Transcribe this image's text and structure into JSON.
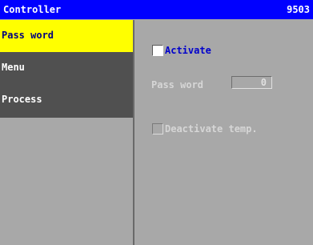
{
  "titlebar": {
    "title": "Controller",
    "code": "9503"
  },
  "sidebar": {
    "items": [
      {
        "label": "Pass word",
        "active": true
      },
      {
        "label": "Menu",
        "active": false
      },
      {
        "label": "Process",
        "active": false
      }
    ]
  },
  "main": {
    "activate_label": "Activate",
    "activate_checked": false,
    "password_label": "Pass word",
    "password_value": "0",
    "deactivate_label": "Deactivate temp.",
    "deactivate_checked": false
  },
  "colors": {
    "titlebar": "#0000ff",
    "active_nav": "#ffff00",
    "nav_bg": "#505050",
    "panel_bg": "#a8a8a8",
    "activate_text": "#0000cc"
  }
}
